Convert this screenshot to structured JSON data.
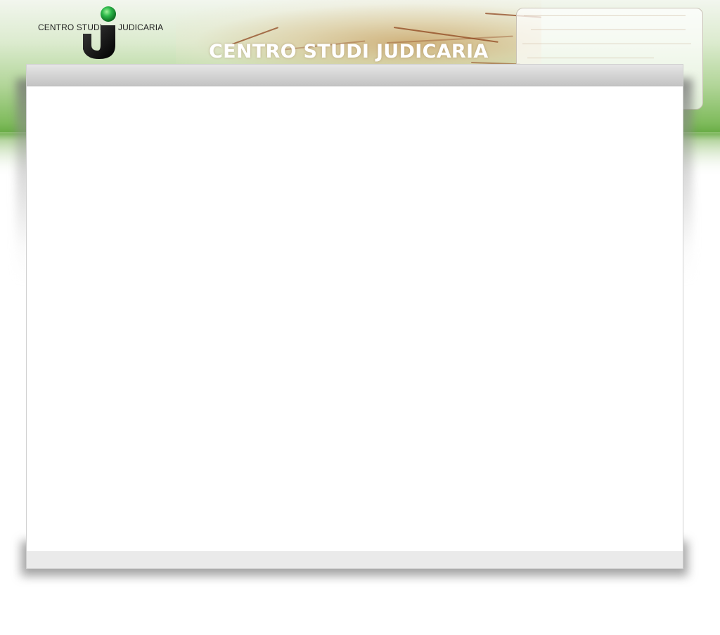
{
  "header": {
    "logo_left_text": "CENTRO STUDI",
    "logo_right_text": "JUDICARIA",
    "site_title": "CENTRO STUDI JUDICARIA"
  },
  "colors": {
    "header_green": "#6aad47",
    "logo_green": "#2db84a",
    "title_text": "#ffffff",
    "nav_bar": "#cfcfcf",
    "footer_bar": "#eaeaea"
  },
  "icons": {
    "logo": "centro-studi-judicaria-logo"
  }
}
